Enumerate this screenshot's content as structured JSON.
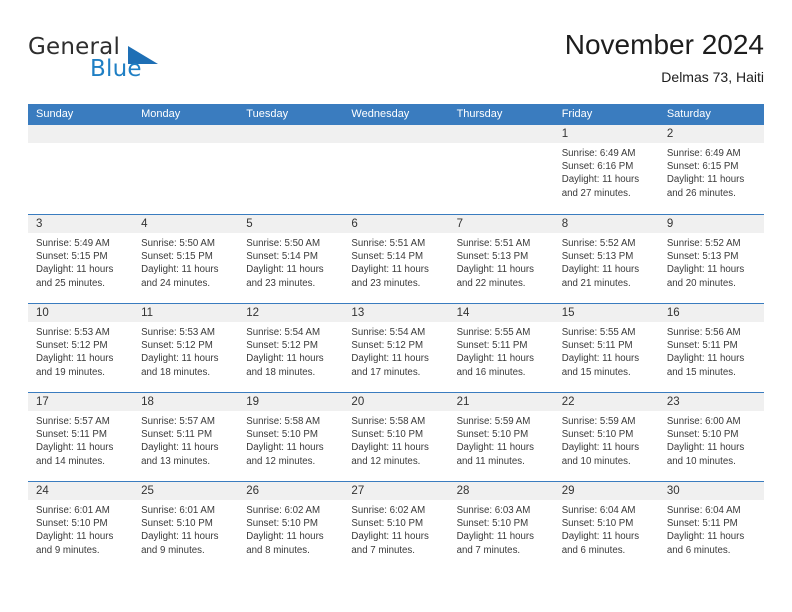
{
  "brand": {
    "word_one": "General",
    "word_two": "Blue",
    "triangle_icon": "triangle-icon",
    "colors": {
      "blue": "#1f7fc4",
      "triangle": "#1e6fb5",
      "dark": "#2e2e2e"
    }
  },
  "header": {
    "title": "November 2024",
    "subtitle": "Delmas 73, Haiti"
  },
  "theme": {
    "header_blue": "#3a7cbf",
    "date_band_gray": "#f0f0f0",
    "text": "#3a3a3a"
  },
  "weekdays": [
    "Sunday",
    "Monday",
    "Tuesday",
    "Wednesday",
    "Thursday",
    "Friday",
    "Saturday"
  ],
  "weeks": [
    [
      {
        "day": "",
        "sunrise": "",
        "sunset": "",
        "daylight_line1": "",
        "daylight_line2": "",
        "empty": true
      },
      {
        "day": "",
        "sunrise": "",
        "sunset": "",
        "daylight_line1": "",
        "daylight_line2": "",
        "empty": true
      },
      {
        "day": "",
        "sunrise": "",
        "sunset": "",
        "daylight_line1": "",
        "daylight_line2": "",
        "empty": true
      },
      {
        "day": "",
        "sunrise": "",
        "sunset": "",
        "daylight_line1": "",
        "daylight_line2": "",
        "empty": true
      },
      {
        "day": "",
        "sunrise": "",
        "sunset": "",
        "daylight_line1": "",
        "daylight_line2": "",
        "empty": true
      },
      {
        "day": "1",
        "sunrise": "Sunrise: 6:49 AM",
        "sunset": "Sunset: 6:16 PM",
        "daylight_line1": "Daylight: 11 hours",
        "daylight_line2": "and 27 minutes.",
        "empty": false
      },
      {
        "day": "2",
        "sunrise": "Sunrise: 6:49 AM",
        "sunset": "Sunset: 6:15 PM",
        "daylight_line1": "Daylight: 11 hours",
        "daylight_line2": "and 26 minutes.",
        "empty": false
      }
    ],
    [
      {
        "day": "3",
        "sunrise": "Sunrise: 5:49 AM",
        "sunset": "Sunset: 5:15 PM",
        "daylight_line1": "Daylight: 11 hours",
        "daylight_line2": "and 25 minutes.",
        "empty": false
      },
      {
        "day": "4",
        "sunrise": "Sunrise: 5:50 AM",
        "sunset": "Sunset: 5:15 PM",
        "daylight_line1": "Daylight: 11 hours",
        "daylight_line2": "and 24 minutes.",
        "empty": false
      },
      {
        "day": "5",
        "sunrise": "Sunrise: 5:50 AM",
        "sunset": "Sunset: 5:14 PM",
        "daylight_line1": "Daylight: 11 hours",
        "daylight_line2": "and 23 minutes.",
        "empty": false
      },
      {
        "day": "6",
        "sunrise": "Sunrise: 5:51 AM",
        "sunset": "Sunset: 5:14 PM",
        "daylight_line1": "Daylight: 11 hours",
        "daylight_line2": "and 23 minutes.",
        "empty": false
      },
      {
        "day": "7",
        "sunrise": "Sunrise: 5:51 AM",
        "sunset": "Sunset: 5:13 PM",
        "daylight_line1": "Daylight: 11 hours",
        "daylight_line2": "and 22 minutes.",
        "empty": false
      },
      {
        "day": "8",
        "sunrise": "Sunrise: 5:52 AM",
        "sunset": "Sunset: 5:13 PM",
        "daylight_line1": "Daylight: 11 hours",
        "daylight_line2": "and 21 minutes.",
        "empty": false
      },
      {
        "day": "9",
        "sunrise": "Sunrise: 5:52 AM",
        "sunset": "Sunset: 5:13 PM",
        "daylight_line1": "Daylight: 11 hours",
        "daylight_line2": "and 20 minutes.",
        "empty": false
      }
    ],
    [
      {
        "day": "10",
        "sunrise": "Sunrise: 5:53 AM",
        "sunset": "Sunset: 5:12 PM",
        "daylight_line1": "Daylight: 11 hours",
        "daylight_line2": "and 19 minutes.",
        "empty": false
      },
      {
        "day": "11",
        "sunrise": "Sunrise: 5:53 AM",
        "sunset": "Sunset: 5:12 PM",
        "daylight_line1": "Daylight: 11 hours",
        "daylight_line2": "and 18 minutes.",
        "empty": false
      },
      {
        "day": "12",
        "sunrise": "Sunrise: 5:54 AM",
        "sunset": "Sunset: 5:12 PM",
        "daylight_line1": "Daylight: 11 hours",
        "daylight_line2": "and 18 minutes.",
        "empty": false
      },
      {
        "day": "13",
        "sunrise": "Sunrise: 5:54 AM",
        "sunset": "Sunset: 5:12 PM",
        "daylight_line1": "Daylight: 11 hours",
        "daylight_line2": "and 17 minutes.",
        "empty": false
      },
      {
        "day": "14",
        "sunrise": "Sunrise: 5:55 AM",
        "sunset": "Sunset: 5:11 PM",
        "daylight_line1": "Daylight: 11 hours",
        "daylight_line2": "and 16 minutes.",
        "empty": false
      },
      {
        "day": "15",
        "sunrise": "Sunrise: 5:55 AM",
        "sunset": "Sunset: 5:11 PM",
        "daylight_line1": "Daylight: 11 hours",
        "daylight_line2": "and 15 minutes.",
        "empty": false
      },
      {
        "day": "16",
        "sunrise": "Sunrise: 5:56 AM",
        "sunset": "Sunset: 5:11 PM",
        "daylight_line1": "Daylight: 11 hours",
        "daylight_line2": "and 15 minutes.",
        "empty": false
      }
    ],
    [
      {
        "day": "17",
        "sunrise": "Sunrise: 5:57 AM",
        "sunset": "Sunset: 5:11 PM",
        "daylight_line1": "Daylight: 11 hours",
        "daylight_line2": "and 14 minutes.",
        "empty": false
      },
      {
        "day": "18",
        "sunrise": "Sunrise: 5:57 AM",
        "sunset": "Sunset: 5:11 PM",
        "daylight_line1": "Daylight: 11 hours",
        "daylight_line2": "and 13 minutes.",
        "empty": false
      },
      {
        "day": "19",
        "sunrise": "Sunrise: 5:58 AM",
        "sunset": "Sunset: 5:10 PM",
        "daylight_line1": "Daylight: 11 hours",
        "daylight_line2": "and 12 minutes.",
        "empty": false
      },
      {
        "day": "20",
        "sunrise": "Sunrise: 5:58 AM",
        "sunset": "Sunset: 5:10 PM",
        "daylight_line1": "Daylight: 11 hours",
        "daylight_line2": "and 12 minutes.",
        "empty": false
      },
      {
        "day": "21",
        "sunrise": "Sunrise: 5:59 AM",
        "sunset": "Sunset: 5:10 PM",
        "daylight_line1": "Daylight: 11 hours",
        "daylight_line2": "and 11 minutes.",
        "empty": false
      },
      {
        "day": "22",
        "sunrise": "Sunrise: 5:59 AM",
        "sunset": "Sunset: 5:10 PM",
        "daylight_line1": "Daylight: 11 hours",
        "daylight_line2": "and 10 minutes.",
        "empty": false
      },
      {
        "day": "23",
        "sunrise": "Sunrise: 6:00 AM",
        "sunset": "Sunset: 5:10 PM",
        "daylight_line1": "Daylight: 11 hours",
        "daylight_line2": "and 10 minutes.",
        "empty": false
      }
    ],
    [
      {
        "day": "24",
        "sunrise": "Sunrise: 6:01 AM",
        "sunset": "Sunset: 5:10 PM",
        "daylight_line1": "Daylight: 11 hours",
        "daylight_line2": "and 9 minutes.",
        "empty": false
      },
      {
        "day": "25",
        "sunrise": "Sunrise: 6:01 AM",
        "sunset": "Sunset: 5:10 PM",
        "daylight_line1": "Daylight: 11 hours",
        "daylight_line2": "and 9 minutes.",
        "empty": false
      },
      {
        "day": "26",
        "sunrise": "Sunrise: 6:02 AM",
        "sunset": "Sunset: 5:10 PM",
        "daylight_line1": "Daylight: 11 hours",
        "daylight_line2": "and 8 minutes.",
        "empty": false
      },
      {
        "day": "27",
        "sunrise": "Sunrise: 6:02 AM",
        "sunset": "Sunset: 5:10 PM",
        "daylight_line1": "Daylight: 11 hours",
        "daylight_line2": "and 7 minutes.",
        "empty": false
      },
      {
        "day": "28",
        "sunrise": "Sunrise: 6:03 AM",
        "sunset": "Sunset: 5:10 PM",
        "daylight_line1": "Daylight: 11 hours",
        "daylight_line2": "and 7 minutes.",
        "empty": false
      },
      {
        "day": "29",
        "sunrise": "Sunrise: 6:04 AM",
        "sunset": "Sunset: 5:10 PM",
        "daylight_line1": "Daylight: 11 hours",
        "daylight_line2": "and 6 minutes.",
        "empty": false
      },
      {
        "day": "30",
        "sunrise": "Sunrise: 6:04 AM",
        "sunset": "Sunset: 5:11 PM",
        "daylight_line1": "Daylight: 11 hours",
        "daylight_line2": "and 6 minutes.",
        "empty": false
      }
    ]
  ]
}
